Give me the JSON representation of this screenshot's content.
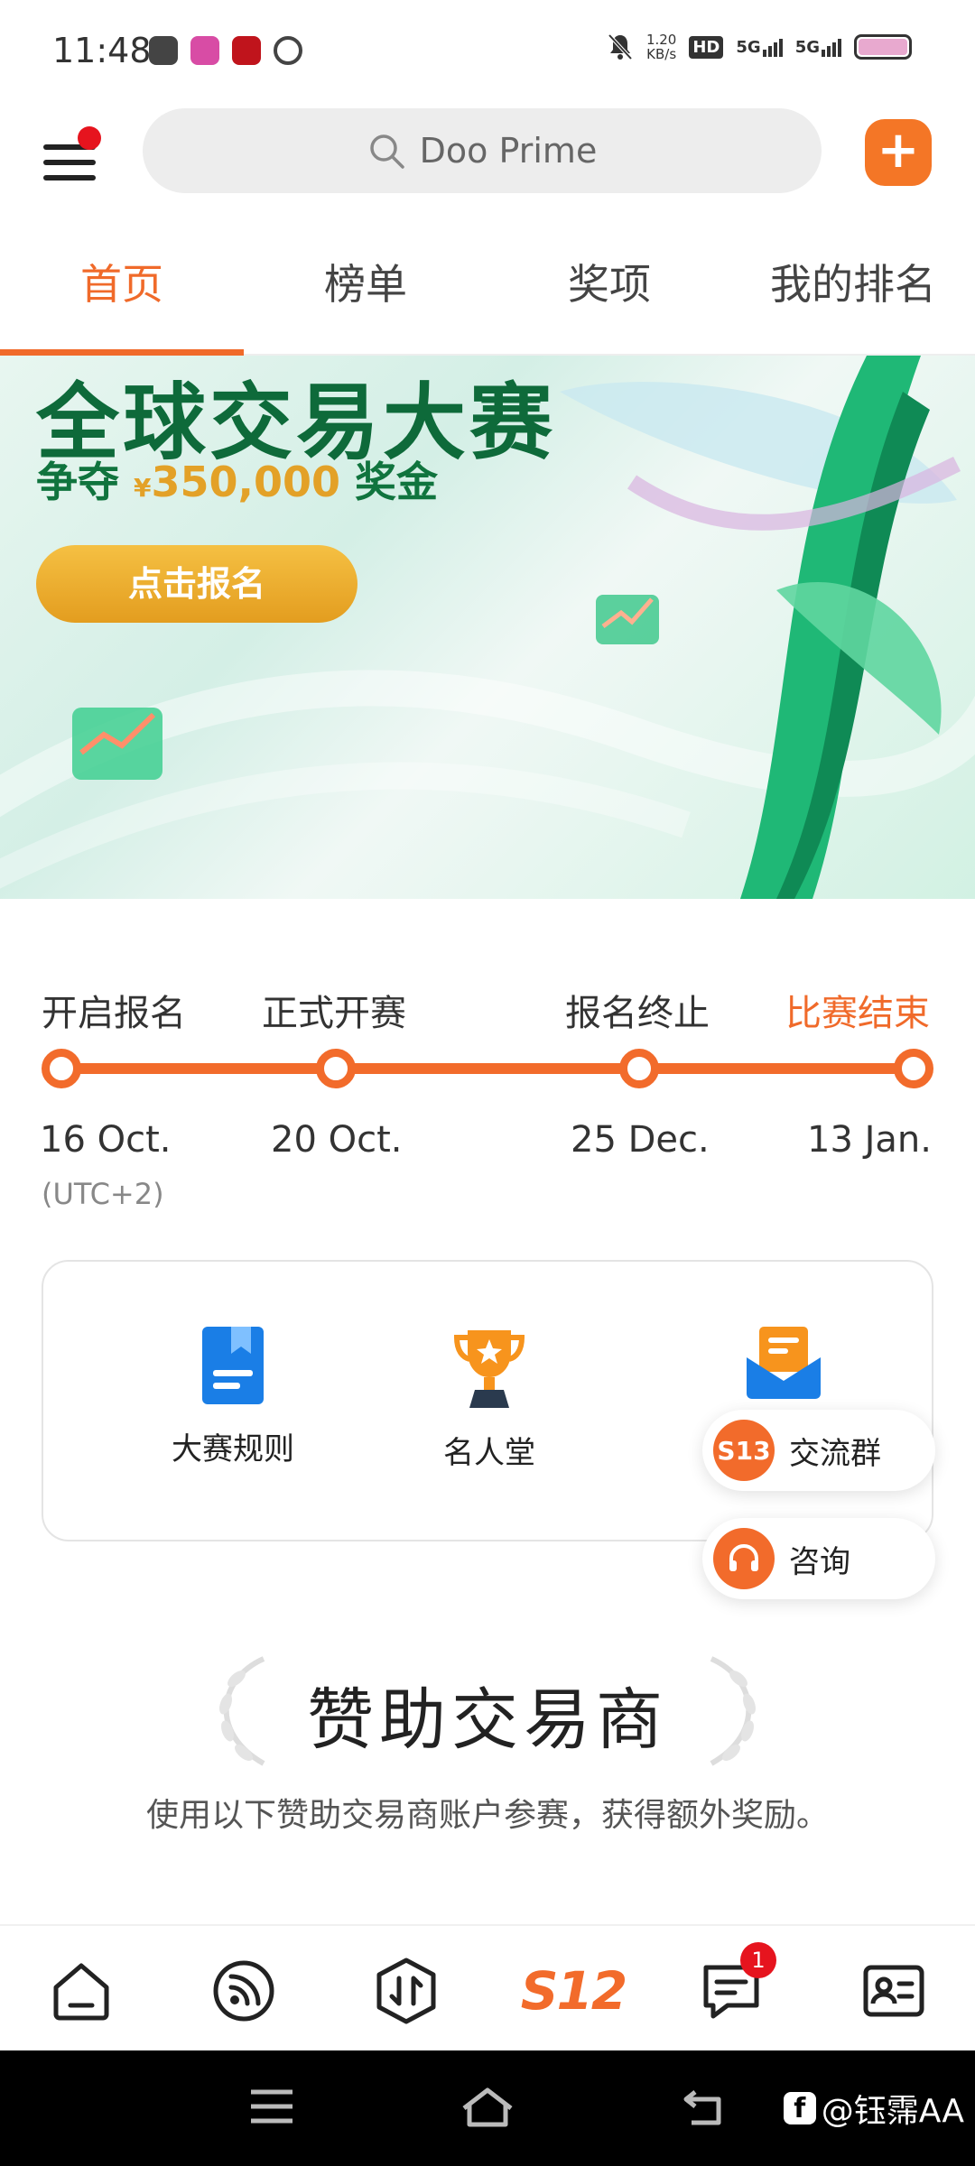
{
  "status_bar": {
    "time": "11:48",
    "net_speed_value": "1.20",
    "net_speed_unit": "KB/s",
    "hd": "HD",
    "signal_1": "5G",
    "signal_2": "5G"
  },
  "header": {
    "search_placeholder": "Doo Prime",
    "add_label": "+"
  },
  "tabs": [
    {
      "label": "首页",
      "active": true
    },
    {
      "label": "榜单",
      "active": false
    },
    {
      "label": "奖项",
      "active": false
    },
    {
      "label": "我的排名",
      "active": false
    }
  ],
  "banner": {
    "title": "全球交易大赛",
    "prize_prefix": "争夺",
    "currency": "¥",
    "prize_amount": "350,000",
    "prize_suffix": "奖金",
    "cta": "点击报名"
  },
  "timeline": {
    "milestones": [
      {
        "label": "开启报名",
        "date": "16 Oct."
      },
      {
        "label": "正式开赛",
        "date": "20 Oct."
      },
      {
        "label": "报名终止",
        "date": "25 Dec."
      },
      {
        "label": "比赛结束",
        "date": "13 Jan."
      }
    ],
    "timezone": "(UTC+2)"
  },
  "features": [
    {
      "label": "大赛规则",
      "icon": "rules-book-icon"
    },
    {
      "label": "名人堂",
      "icon": "trophy-icon"
    },
    {
      "label": "",
      "icon": "mailbox-icon"
    }
  ],
  "floating": {
    "group_badge": "S13",
    "group_label": "交流群",
    "consult_label": "咨询"
  },
  "sponsor": {
    "title": "赞助交易商",
    "subtitle": "使用以下赞助交易商账户参赛，获得额外奖励。"
  },
  "bottom_nav": {
    "items": [
      "home-icon",
      "feed-icon",
      "trade-icon",
      "s12-logo",
      "messages-icon",
      "profile-card-icon"
    ],
    "center_label": "S12",
    "messages_badge": "1"
  },
  "watermark": "@钰霈AA",
  "colors": {
    "accent": "#f26b2b",
    "banner_green": "#0e6a3a",
    "gold": "#e3a127"
  }
}
